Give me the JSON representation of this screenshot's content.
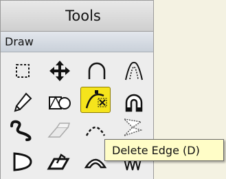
{
  "panel": {
    "title": "Tools",
    "section_label": "Draw"
  },
  "tools": [
    {
      "icon": "rectangular-marquee-icon"
    },
    {
      "icon": "move-arrows-icon"
    },
    {
      "icon": "arc-curve-icon"
    },
    {
      "icon": "dotted-arc-icon"
    },
    {
      "icon": "pencil-icon"
    },
    {
      "icon": "shapes-icon"
    },
    {
      "icon": "delete-edge-icon",
      "selected": true
    },
    {
      "icon": "magnet-icon"
    },
    {
      "icon": "freehand-curve-icon"
    },
    {
      "icon": "eraser-icon"
    },
    {
      "icon": "dotted-arch-icon"
    },
    {
      "icon": "triangles-icon"
    },
    {
      "icon": "polygon-icon"
    },
    {
      "icon": "extrude-icon"
    },
    {
      "icon": "bend-icon"
    },
    {
      "icon": "spikes-icon"
    }
  ],
  "tooltip": {
    "text": "Delete Edge (D)"
  },
  "colors": {
    "selected_background": "#f5e41c",
    "tooltip_background": "#fffdc7",
    "canvas_background": "#f4f2e2"
  }
}
